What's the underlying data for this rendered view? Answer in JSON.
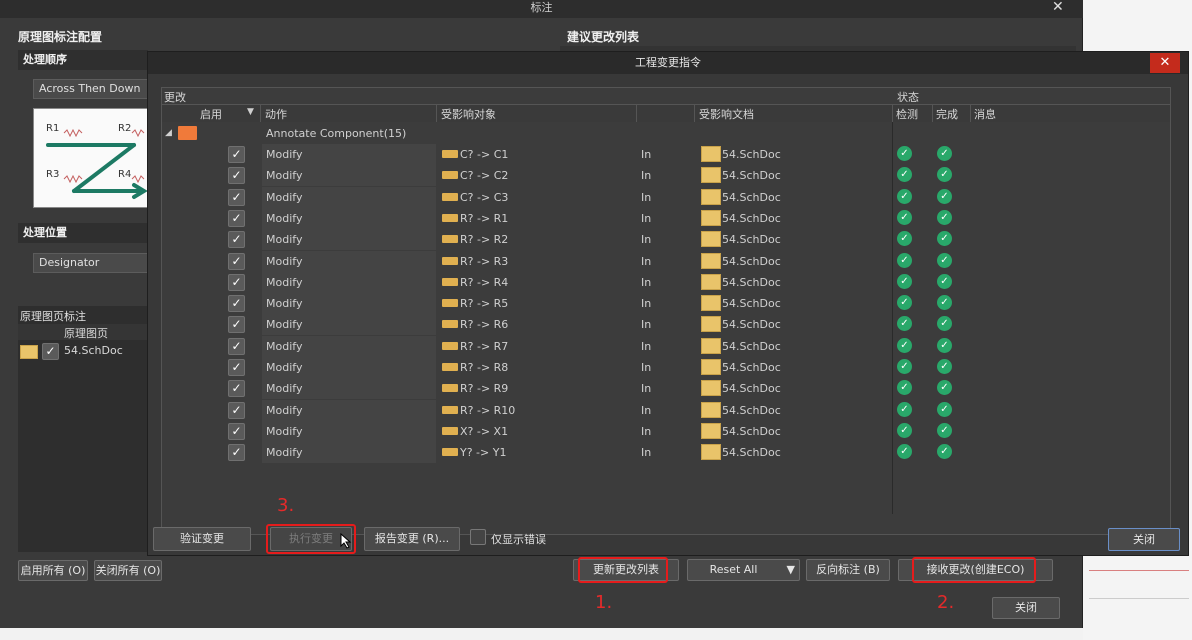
{
  "outer": {
    "title": "标注",
    "config_title": "原理图标注配置",
    "suggest_title": "建议更改列表",
    "order_heading": "处理顺序",
    "order_value": "Across Then Down",
    "preview_labels": [
      "R1",
      "R2",
      "R3",
      "R4"
    ],
    "location_heading": "处理位置",
    "location_value": "Designator",
    "sheets_heading": "原理图页标注",
    "sheets_col": "原理图页",
    "sheet_name": "54.SchDoc",
    "enable_all": "启用所有 (O)",
    "close_all": "关闭所有 (O)",
    "update_list": "更新更改列表",
    "reset_all": "Reset All",
    "back_annotate": "反向标注 (B)",
    "accept_changes": "接收更改(创建ECO)",
    "close": "关闭",
    "step1": "1.",
    "step2": "2."
  },
  "eco": {
    "title": "工程变更指令",
    "close_icon": "close-icon",
    "group_changes": "更改",
    "group_status": "状态",
    "col_enable": "启用",
    "col_action": "动作",
    "col_object": "受影响对象",
    "col_document": "受影响文档",
    "col_check": "检测",
    "col_done": "完成",
    "col_message": "消息",
    "group_row": "Annotate Component(15)",
    "rows": [
      {
        "action": "Modify",
        "object": "C? -> C1",
        "in": "In",
        "doc": "54.SchDoc"
      },
      {
        "action": "Modify",
        "object": "C? -> C2",
        "in": "In",
        "doc": "54.SchDoc"
      },
      {
        "action": "Modify",
        "object": "C? -> C3",
        "in": "In",
        "doc": "54.SchDoc"
      },
      {
        "action": "Modify",
        "object": "R? -> R1",
        "in": "In",
        "doc": "54.SchDoc"
      },
      {
        "action": "Modify",
        "object": "R? -> R2",
        "in": "In",
        "doc": "54.SchDoc"
      },
      {
        "action": "Modify",
        "object": "R? -> R3",
        "in": "In",
        "doc": "54.SchDoc"
      },
      {
        "action": "Modify",
        "object": "R? -> R4",
        "in": "In",
        "doc": "54.SchDoc"
      },
      {
        "action": "Modify",
        "object": "R? -> R5",
        "in": "In",
        "doc": "54.SchDoc"
      },
      {
        "action": "Modify",
        "object": "R? -> R6",
        "in": "In",
        "doc": "54.SchDoc"
      },
      {
        "action": "Modify",
        "object": "R? -> R7",
        "in": "In",
        "doc": "54.SchDoc"
      },
      {
        "action": "Modify",
        "object": "R? -> R8",
        "in": "In",
        "doc": "54.SchDoc"
      },
      {
        "action": "Modify",
        "object": "R? -> R9",
        "in": "In",
        "doc": "54.SchDoc"
      },
      {
        "action": "Modify",
        "object": "R? -> R10",
        "in": "In",
        "doc": "54.SchDoc"
      },
      {
        "action": "Modify",
        "object": "X? -> X1",
        "in": "In",
        "doc": "54.SchDoc"
      },
      {
        "action": "Modify",
        "object": "Y? -> Y1",
        "in": "In",
        "doc": "54.SchDoc"
      }
    ],
    "validate": "验证变更",
    "execute": "执行变更",
    "report": "报告变更 (R)...",
    "only_errors": "仅显示错误",
    "close": "关闭",
    "step3": "3."
  },
  "colors": {
    "accent_red": "#e51c1c",
    "status_green": "#29a86a",
    "close_red": "#c42b1c"
  }
}
